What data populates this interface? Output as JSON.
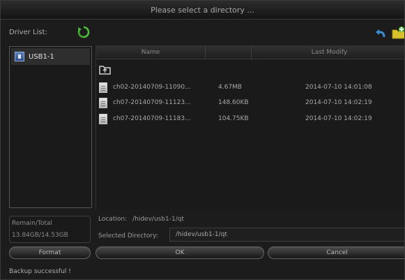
{
  "dialog": {
    "title": "Please select a directory ..."
  },
  "driver_panel": {
    "label": "Driver List:",
    "items": [
      {
        "label": "USB1-1",
        "selected": true
      }
    ]
  },
  "file_list": {
    "columns": [
      "Name",
      "",
      "Last Modify"
    ],
    "rows": [
      {
        "name": "ch02-20140709-11090...",
        "size": "4.67MB",
        "modified": "2014-07-10 14:01:08"
      },
      {
        "name": "ch07-20140709-11123...",
        "size": "148.60KB",
        "modified": "2014-07-10 14:02:19"
      },
      {
        "name": "ch07-20140709-11183...",
        "size": "104.75KB",
        "modified": "2014-07-10 14:02:19"
      }
    ]
  },
  "storage": {
    "label": "Remain/Total",
    "value": "13.84GB/14.53GB"
  },
  "location": {
    "label": "Location:",
    "value": "/hidev/usb1-1/qt"
  },
  "selected_directory": {
    "label": "Selected Directory:",
    "value": "/hidev/usb1-1/qt"
  },
  "buttons": {
    "format": "Format",
    "ok": "OK",
    "cancel": "Cancel"
  },
  "status": "Backup successful !",
  "colors": {
    "background": "#1c1c1c",
    "accent_green": "#4fbf3a",
    "accent_blue": "#3a8fd8",
    "folder_yellow": "#d8c22a"
  }
}
